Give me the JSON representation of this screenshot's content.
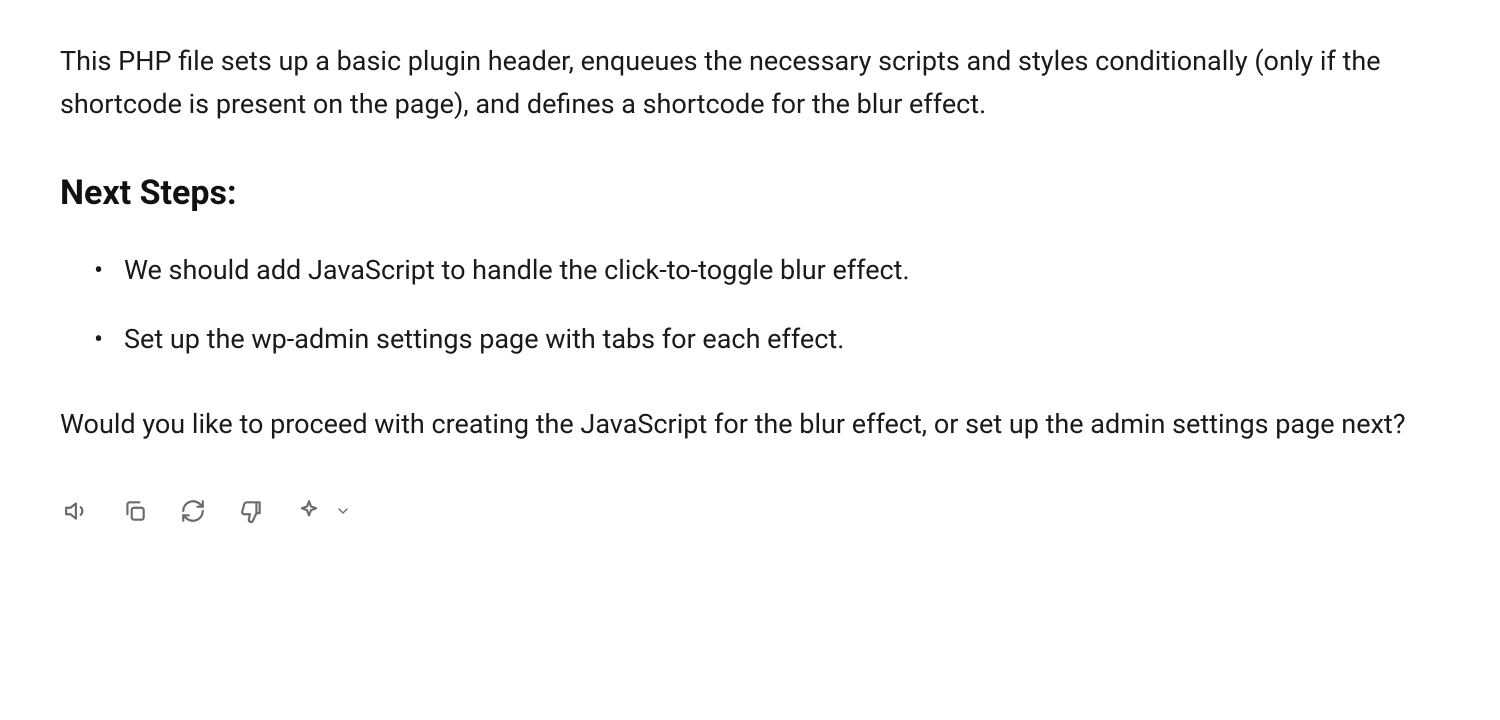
{
  "intro": "This PHP file sets up a basic plugin header, enqueues the necessary scripts and styles conditionally (only if the shortcode is present on the page), and defines a shortcode for the blur effect.",
  "heading": "Next Steps:",
  "steps": [
    "We should add JavaScript to handle the click-to-toggle blur effect.",
    "Set up the wp-admin settings page with tabs for each effect."
  ],
  "closing": "Would you like to proceed with creating the JavaScript for the blur effect, or set up the admin settings page next?",
  "icons": {
    "speaker": "speaker-icon",
    "copy": "copy-icon",
    "refresh": "refresh-icon",
    "thumbs_down": "thumbs-down-icon",
    "sparkle": "sparkle-icon",
    "chevron": "chevron-down-icon"
  }
}
